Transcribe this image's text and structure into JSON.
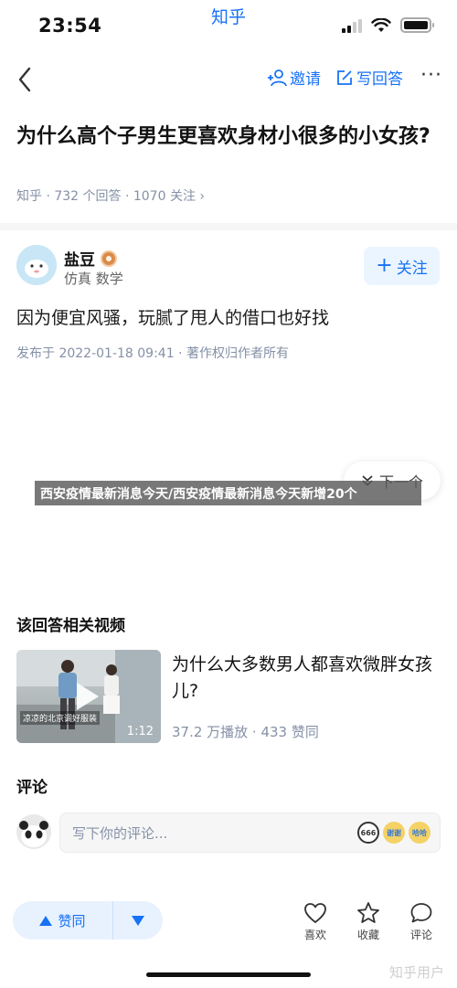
{
  "status_bar": {
    "time": "23:54",
    "app_label": "知乎"
  },
  "nav": {
    "invite": "邀请",
    "write_answer": "写回答",
    "more": "···"
  },
  "question": {
    "title": "为什么高个子男生更喜欢身材小很多的小女孩?",
    "meta": "知乎 · 732 个回答 · 1070 关注 ›"
  },
  "author": {
    "name": "盐豆",
    "bio": "仿真 数学",
    "follow": "关注"
  },
  "answer": {
    "text": "因为便宜风骚，玩腻了甩人的借口也好找",
    "published": "发布于 2022-01-18 09:41 · 著作权归作者所有"
  },
  "next_button": "下一个",
  "banner": "西安疫情最新消息今天/西安疫情最新消息今天新增20个",
  "related_video": {
    "section_title": "该回答相关视频",
    "thumb_caption": "凉凉的北京调好服装",
    "duration": "1:12",
    "title": "为什么大多数男人都喜欢微胖女孩儿?",
    "meta": "37.2 万播放 · 433 赞同"
  },
  "comments": {
    "section_title": "评论",
    "placeholder": "写下你的评论...",
    "emojis": [
      "666",
      "谢谢",
      "哈哈"
    ]
  },
  "bottom_bar": {
    "upvote": "赞同",
    "like": "喜欢",
    "collect": "收藏",
    "comment": "评论"
  },
  "watermark": "知乎用户",
  "colors": {
    "accent": "#1772f6",
    "meta_gray": "#8590a6",
    "follow_bg": "#ebf5ff"
  }
}
